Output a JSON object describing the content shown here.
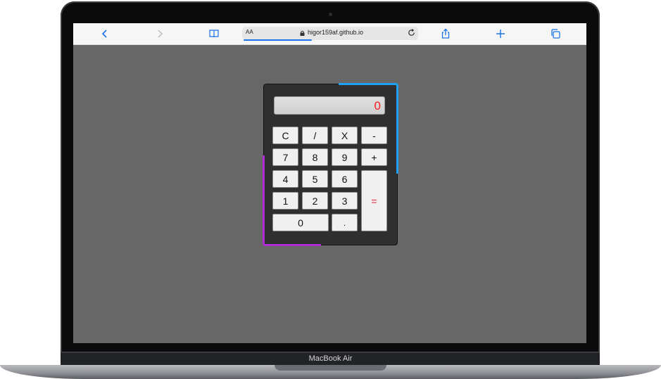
{
  "device": {
    "label": "MacBook Air"
  },
  "browser": {
    "reader_label": "AA",
    "url": "higor159af.github.io",
    "icons": {
      "back": "chevron-left-icon",
      "forward": "chevron-right-icon",
      "bookmarks": "book-icon",
      "lock": "lock-icon",
      "reload": "reload-icon",
      "share": "share-icon",
      "new_tab": "plus-icon",
      "tabs": "tabs-icon"
    }
  },
  "calculator": {
    "display": "0",
    "keys": {
      "clear": "C",
      "divide": "/",
      "multiply": "X",
      "minus": "-",
      "seven": "7",
      "eight": "8",
      "nine": "9",
      "plus": "+",
      "four": "4",
      "five": "5",
      "six": "6",
      "one": "1",
      "two": "2",
      "three": "3",
      "equals": "=",
      "zero": "0",
      "dot": "."
    },
    "colors": {
      "accent_top": "#1fa0f2",
      "accent_bottom": "#b02bd1",
      "display_text": "#ff1a1a",
      "equals_text": "#e0203a"
    }
  }
}
